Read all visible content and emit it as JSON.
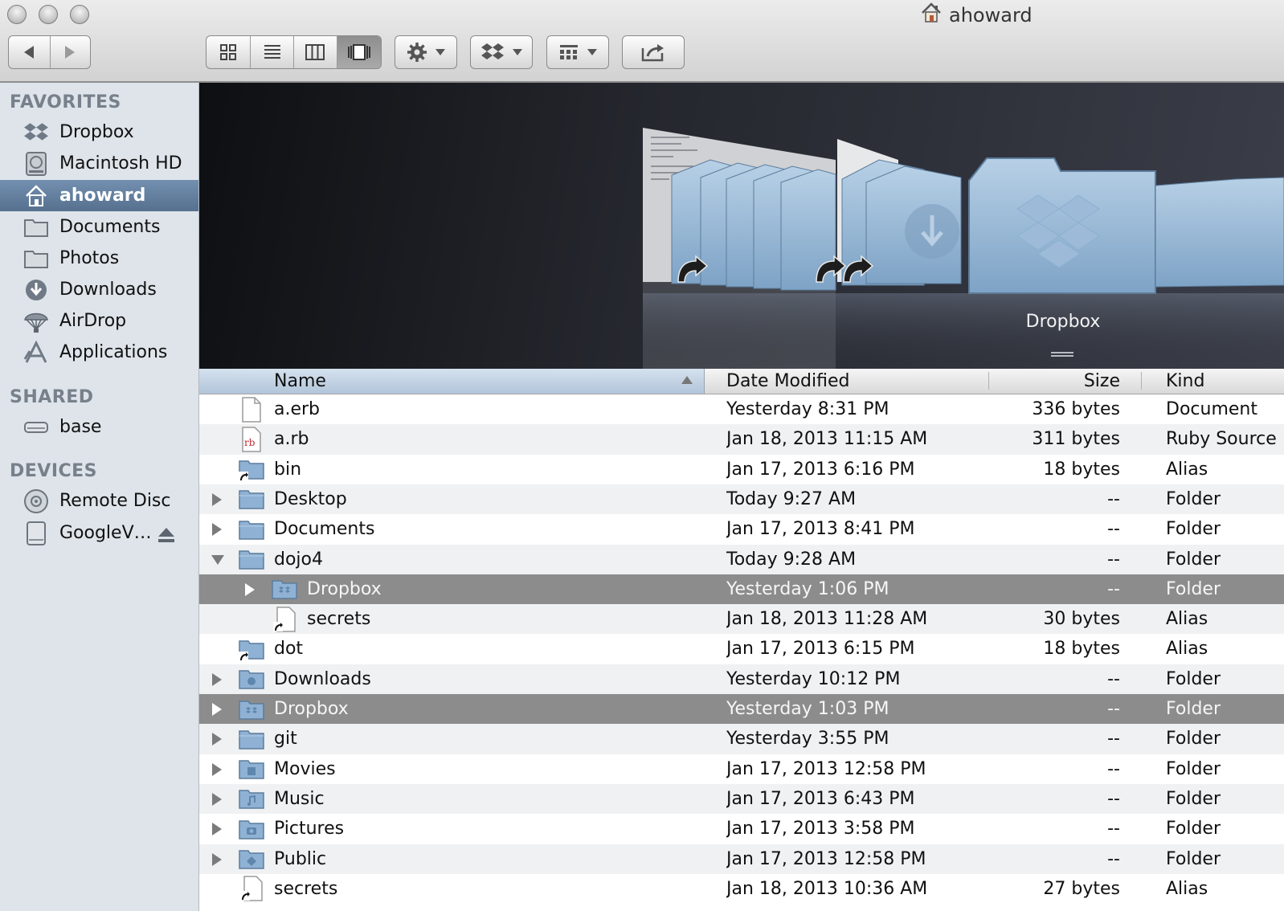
{
  "window": {
    "title": "ahoward"
  },
  "toolbar": {
    "view_modes": [
      "icon-view",
      "list-view",
      "column-view",
      "cover-flow-view"
    ],
    "active_view": "cover-flow-view"
  },
  "sidebar": {
    "favorites_heading": "FAVORITES",
    "favorites": [
      {
        "label": "Dropbox",
        "icon": "dropbox-icon"
      },
      {
        "label": "Macintosh HD",
        "icon": "hard-drive-icon"
      },
      {
        "label": "ahoward",
        "icon": "home-icon",
        "selected": true
      },
      {
        "label": "Documents",
        "icon": "folder-icon"
      },
      {
        "label": "Photos",
        "icon": "folder-icon"
      },
      {
        "label": "Downloads",
        "icon": "downloads-icon"
      },
      {
        "label": "AirDrop",
        "icon": "airdrop-icon"
      },
      {
        "label": "Applications",
        "icon": "applications-icon"
      }
    ],
    "shared_heading": "SHARED",
    "shared": [
      {
        "label": "base",
        "icon": "network-drive-icon"
      }
    ],
    "devices_heading": "DEVICES",
    "devices": [
      {
        "label": "Remote Disc",
        "icon": "disc-icon"
      },
      {
        "label": "GoogleV…",
        "icon": "external-drive-icon",
        "ejectable": true
      }
    ]
  },
  "coverflow": {
    "current_label": "Dropbox"
  },
  "columns": {
    "name": "Name",
    "date": "Date Modified",
    "size": "Size",
    "kind": "Kind"
  },
  "files": [
    {
      "name": "a.erb",
      "date": "Yesterday 8:31 PM",
      "size": "336 bytes",
      "kind": "Document",
      "icon": "document-icon",
      "expander": "none",
      "depth": 0
    },
    {
      "name": "a.rb",
      "date": "Jan 18, 2013 11:15 AM",
      "size": "311 bytes",
      "kind": "Ruby Source",
      "icon": "ruby-file-icon",
      "expander": "none",
      "depth": 0
    },
    {
      "name": "bin",
      "date": "Jan 17, 2013 6:16 PM",
      "size": "18 bytes",
      "kind": "Alias",
      "icon": "alias-folder-icon",
      "expander": "none",
      "depth": 0
    },
    {
      "name": "Desktop",
      "date": "Today 9:27 AM",
      "size": "--",
      "kind": "Folder",
      "icon": "folder-icon",
      "expander": "closed",
      "depth": 0
    },
    {
      "name": "Documents",
      "date": "Jan 17, 2013 8:41 PM",
      "size": "--",
      "kind": "Folder",
      "icon": "folder-icon",
      "expander": "closed",
      "depth": 0
    },
    {
      "name": "dojo4",
      "date": "Today 9:28 AM",
      "size": "--",
      "kind": "Folder",
      "icon": "folder-icon",
      "expander": "open",
      "depth": 0
    },
    {
      "name": "Dropbox",
      "date": "Yesterday 1:06 PM",
      "size": "--",
      "kind": "Folder",
      "icon": "dropbox-folder-icon",
      "expander": "closed",
      "depth": 1,
      "selected": true
    },
    {
      "name": "secrets",
      "date": "Jan 18, 2013 11:28 AM",
      "size": "30 bytes",
      "kind": "Alias",
      "icon": "alias-file-icon",
      "expander": "none",
      "depth": 1
    },
    {
      "name": "dot",
      "date": "Jan 17, 2013 6:15 PM",
      "size": "18 bytes",
      "kind": "Alias",
      "icon": "alias-folder-icon",
      "expander": "none",
      "depth": 0
    },
    {
      "name": "Downloads",
      "date": "Yesterday 10:12 PM",
      "size": "--",
      "kind": "Folder",
      "icon": "downloads-folder-icon",
      "expander": "closed",
      "depth": 0
    },
    {
      "name": "Dropbox",
      "date": "Yesterday 1:03 PM",
      "size": "--",
      "kind": "Folder",
      "icon": "dropbox-folder-icon",
      "expander": "closed",
      "depth": 0,
      "selected": true
    },
    {
      "name": "git",
      "date": "Yesterday 3:55 PM",
      "size": "--",
      "kind": "Folder",
      "icon": "folder-icon",
      "expander": "closed",
      "depth": 0
    },
    {
      "name": "Movies",
      "date": "Jan 17, 2013 12:58 PM",
      "size": "--",
      "kind": "Folder",
      "icon": "movies-folder-icon",
      "expander": "closed",
      "depth": 0
    },
    {
      "name": "Music",
      "date": "Jan 17, 2013 6:43 PM",
      "size": "--",
      "kind": "Folder",
      "icon": "music-folder-icon",
      "expander": "closed",
      "depth": 0
    },
    {
      "name": "Pictures",
      "date": "Jan 17, 2013 3:58 PM",
      "size": "--",
      "kind": "Folder",
      "icon": "pictures-folder-icon",
      "expander": "closed",
      "depth": 0
    },
    {
      "name": "Public",
      "date": "Jan 17, 2013 12:58 PM",
      "size": "--",
      "kind": "Folder",
      "icon": "public-folder-icon",
      "expander": "closed",
      "depth": 0
    },
    {
      "name": "secrets",
      "date": "Jan 18, 2013 10:36 AM",
      "size": "27 bytes",
      "kind": "Alias",
      "icon": "alias-file-icon",
      "expander": "none",
      "depth": 0
    }
  ],
  "colors": {
    "selection_row": "#8c8c8c",
    "sidebar_selection": "#5f7a9a",
    "sidebar_bg": "#dee4ea",
    "folder_blue": "#8fb2d4"
  }
}
